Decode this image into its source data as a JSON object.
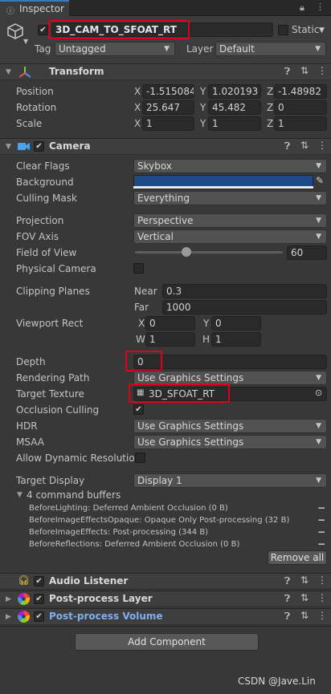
{
  "tab": {
    "label": "Inspector"
  },
  "header": {
    "object_name": "3D_CAM_TO_SFOAT_RT",
    "static_label": "Static",
    "tag_label": "Tag",
    "tag_value": "Untagged",
    "layer_label": "Layer",
    "layer_value": "Default"
  },
  "transform": {
    "title": "Transform",
    "position_label": "Position",
    "rotation_label": "Rotation",
    "scale_label": "Scale",
    "axes": [
      "X",
      "Y",
      "Z"
    ],
    "position": [
      "-1.515084",
      "1.020193",
      "-1.48982"
    ],
    "rotation": [
      "25.647",
      "45.482",
      "0"
    ],
    "scale": [
      "1",
      "1",
      "1"
    ]
  },
  "camera": {
    "title": "Camera",
    "clear_flags_label": "Clear Flags",
    "clear_flags": "Skybox",
    "background_label": "Background",
    "background_color": "#1f4a88",
    "culling_mask_label": "Culling Mask",
    "culling_mask": "Everything",
    "projection_label": "Projection",
    "projection": "Perspective",
    "fov_axis_label": "FOV Axis",
    "fov_axis": "Vertical",
    "fov_label": "Field of View",
    "fov_value": "60",
    "physical_label": "Physical Camera",
    "clipping_label": "Clipping Planes",
    "near_label": "Near",
    "near_value": "0.3",
    "far_label": "Far",
    "far_value": "1000",
    "viewport_label": "Viewport Rect",
    "vp_x_label": "X",
    "vp_x": "0",
    "vp_y_label": "Y",
    "vp_y": "0",
    "vp_w_label": "W",
    "vp_w": "1",
    "vp_h_label": "H",
    "vp_h": "1",
    "depth_label": "Depth",
    "depth_value": "0",
    "render_path_label": "Rendering Path",
    "render_path": "Use Graphics Settings",
    "target_texture_label": "Target Texture",
    "target_texture": "3D_SFOAT_RT",
    "occlusion_label": "Occlusion Culling",
    "hdr_label": "HDR",
    "hdr_value": "Use Graphics Settings",
    "msaa_label": "MSAA",
    "msaa_value": "Use Graphics Settings",
    "dynres_label": "Allow Dynamic Resolution",
    "target_display_label": "Target Display",
    "target_display": "Display 1",
    "cmd_buffers_label": "4 command buffers",
    "cmd_buffers": [
      "BeforeLighting: Deferred Ambient Occlusion (0 B)",
      "BeforeImageEffectsOpaque: Opaque Only Post-processing (32 B)",
      "BeforeImageEffects: Post-processing (344 B)",
      "BeforeReflections: Deferred Ambient Occlusion (0 B)"
    ],
    "remove_all": "Remove all"
  },
  "components": {
    "audio_listener": "Audio Listener",
    "pp_layer": "Post-process Layer",
    "pp_volume": "Post-process Volume"
  },
  "add_component": "Add Component",
  "watermark": "CSDN @Jave.Lin",
  "colors": {
    "accent": "#3a79bb",
    "highlight_box": "#e0001c",
    "link_blue": "#7faff3"
  }
}
